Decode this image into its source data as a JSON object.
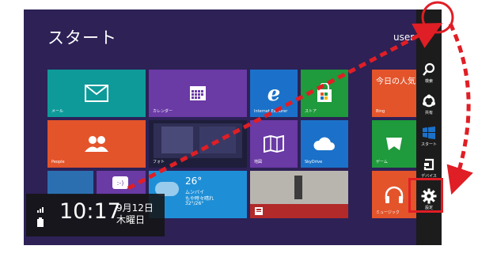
{
  "start": {
    "title": "スタート",
    "user": "user"
  },
  "tiles": {
    "mail": "メール",
    "calendar": "カレンダー",
    "ie": "Internet Explorer",
    "store": "ストア",
    "bing": "Bing",
    "bing_text": "今日の人気",
    "people": "People",
    "photos": "フォト",
    "maps": "地図",
    "skydrive": "SkyDrive",
    "games": "ゲーム",
    "weather_temp": "26°",
    "weather_city": "ムンバイ",
    "weather_condition": "もや時々晴れ",
    "weather_range": "32°/26°",
    "music": "ミュージック"
  },
  "charms": {
    "search": "検索",
    "share": "共有",
    "start": "スタート",
    "devices": "デバイス",
    "settings": "設定"
  },
  "clock": {
    "time": "10:17",
    "date": "9月12日",
    "weekday": "木曜日"
  },
  "colors": {
    "background": "#2d2156",
    "charm_bar": "#1c1c1c",
    "annotation": "#e01e25",
    "teal": "#0f9a9a",
    "purple": "#6a3aa5",
    "blue": "#1b71c9",
    "orange": "#e3542b",
    "green": "#1f9a3c"
  }
}
